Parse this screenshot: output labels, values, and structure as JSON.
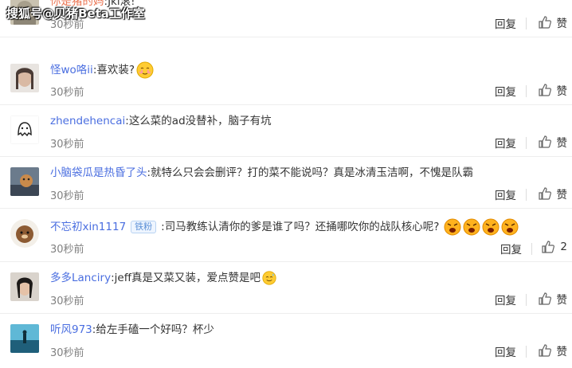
{
  "watermark": "搜狐号@贝猪Beta工作室",
  "comments": [
    {
      "user": "你是猪的妈",
      "text": "Jkl滚!",
      "time": "30秒前",
      "reply": "回复",
      "like": "赞"
    },
    {
      "user": "怪wo咯ii",
      "text": "喜欢装?",
      "time": "30秒前",
      "reply": "回复",
      "like": "赞",
      "emoji": "embarrassed-emoji"
    },
    {
      "user": "zhendehencai",
      "text": "这么菜的ad没替补，脑子有坑",
      "time": "30秒前",
      "reply": "回复",
      "like": "赞"
    },
    {
      "user": "小脑袋瓜是热昏了头",
      "text": "就特么只会会删评？打的菜不能说吗？真是冰清玉洁啊，不愧是队霸",
      "time": "30秒前",
      "reply": "回复",
      "like": "赞"
    },
    {
      "user": "不忘初xin1117",
      "badge": "铁粉",
      "text": "司马教练认清你的爹是谁了吗？还捅哪吹你的战队核心呢?",
      "time": "30秒前",
      "reply": "回复",
      "like": "2",
      "emoji": "angry-emoji"
    },
    {
      "user": "多多Lanciry",
      "text": "jeff真是又菜又装，爱点赞是吧",
      "time": "30秒前",
      "reply": "回复",
      "like": "赞",
      "emoji": "sweat-emoji"
    },
    {
      "user": "听风973",
      "text": "给左手磕一个好吗？杯少",
      "time": "30秒前",
      "reply": "回复",
      "like": "赞"
    }
  ],
  "colors": {
    "username": "#eb7350",
    "username_blue": "#4a6ee0",
    "time": "#808080",
    "badge": "#5a8fd6"
  }
}
